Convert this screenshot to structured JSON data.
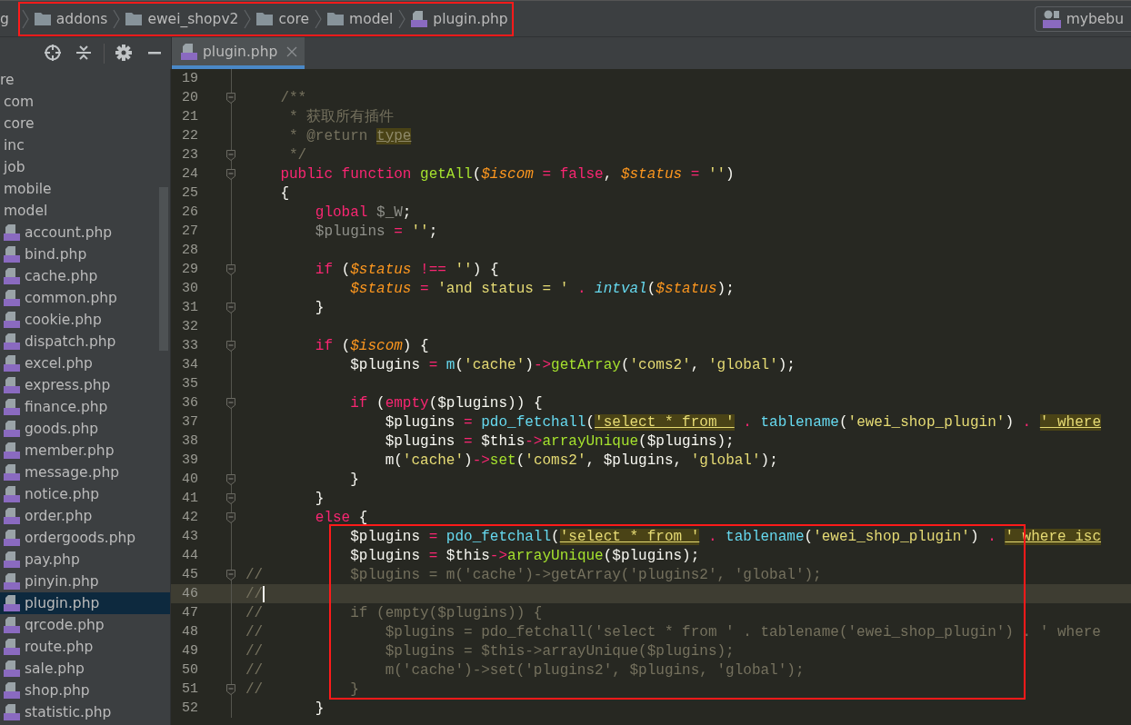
{
  "breadcrumb": {
    "outlined": true,
    "items": [
      {
        "label": "g",
        "kind": "partial"
      },
      {
        "label": "addons",
        "kind": "folder"
      },
      {
        "label": "ewei_shopv2",
        "kind": "folder"
      },
      {
        "label": "core",
        "kind": "folder"
      },
      {
        "label": "model",
        "kind": "folder"
      },
      {
        "label": "plugin.php",
        "kind": "php"
      }
    ]
  },
  "run_config": {
    "label": "mybebu"
  },
  "tabs": [
    {
      "label": "plugin.php",
      "selected": true
    }
  ],
  "sidebar": {
    "items": [
      {
        "label": "re",
        "kind": "folder",
        "selected": false
      },
      {
        "label": "com",
        "kind": "folder",
        "selected": false
      },
      {
        "label": "core",
        "kind": "folder",
        "selected": false
      },
      {
        "label": "inc",
        "kind": "folder",
        "selected": false
      },
      {
        "label": "job",
        "kind": "folder",
        "selected": false
      },
      {
        "label": "mobile",
        "kind": "folder",
        "selected": false
      },
      {
        "label": "model",
        "kind": "folder",
        "selected": false
      },
      {
        "label": "account.php",
        "kind": "php",
        "selected": false
      },
      {
        "label": "bind.php",
        "kind": "php",
        "selected": false
      },
      {
        "label": "cache.php",
        "kind": "php",
        "selected": false
      },
      {
        "label": "common.php",
        "kind": "php",
        "selected": false
      },
      {
        "label": "cookie.php",
        "kind": "php",
        "selected": false
      },
      {
        "label": "dispatch.php",
        "kind": "php",
        "selected": false
      },
      {
        "label": "excel.php",
        "kind": "php",
        "selected": false
      },
      {
        "label": "express.php",
        "kind": "php",
        "selected": false
      },
      {
        "label": "finance.php",
        "kind": "php",
        "selected": false
      },
      {
        "label": "goods.php",
        "kind": "php",
        "selected": false
      },
      {
        "label": "member.php",
        "kind": "php",
        "selected": false
      },
      {
        "label": "message.php",
        "kind": "php",
        "selected": false
      },
      {
        "label": "notice.php",
        "kind": "php",
        "selected": false
      },
      {
        "label": "order.php",
        "kind": "php",
        "selected": false
      },
      {
        "label": "ordergoods.php",
        "kind": "php",
        "selected": false
      },
      {
        "label": "pay.php",
        "kind": "php",
        "selected": false
      },
      {
        "label": "pinyin.php",
        "kind": "php",
        "selected": false
      },
      {
        "label": "plugin.php",
        "kind": "php",
        "selected": true
      },
      {
        "label": "qrcode.php",
        "kind": "php",
        "selected": false
      },
      {
        "label": "route.php",
        "kind": "php",
        "selected": false
      },
      {
        "label": "sale.php",
        "kind": "php",
        "selected": false
      },
      {
        "label": "shop.php",
        "kind": "php",
        "selected": false
      },
      {
        "label": "statistic.php",
        "kind": "php",
        "selected": false
      }
    ]
  },
  "editor": {
    "lines": [
      {
        "number": "19",
        "fold": false,
        "current": false,
        "boxed": false
      },
      {
        "number": "20",
        "fold": true,
        "current": false,
        "boxed": false,
        "tokens": [
          {
            "kind": "comment",
            "text": "    /**"
          }
        ]
      },
      {
        "number": "21",
        "fold": false,
        "current": false,
        "boxed": false,
        "tokens": [
          {
            "kind": "comment",
            "text": "     * 获取所有插件"
          }
        ]
      },
      {
        "number": "22",
        "fold": false,
        "current": false,
        "boxed": false,
        "tokens": [
          {
            "kind": "comment",
            "text": "     * @return "
          },
          {
            "kind": "doc-type",
            "text": "type"
          }
        ]
      },
      {
        "number": "23",
        "fold": true,
        "current": false,
        "boxed": false,
        "tokens": [
          {
            "kind": "comment",
            "text": "     */"
          }
        ]
      },
      {
        "number": "24",
        "fold": true,
        "current": false,
        "boxed": false,
        "tokens": [
          {
            "kind": "keyword",
            "text": "    public function "
          },
          {
            "kind": "function",
            "text": "getAll"
          },
          {
            "kind": "plain",
            "text": "("
          },
          {
            "kind": "variable",
            "text": "$iscom"
          },
          {
            "kind": "keyword",
            "text": " = false"
          },
          {
            "kind": "plain",
            "text": ", "
          },
          {
            "kind": "variable",
            "text": "$status"
          },
          {
            "kind": "keyword",
            "text": " = "
          },
          {
            "kind": "string",
            "text": "''"
          },
          {
            "kind": "plain",
            "text": ")"
          }
        ]
      },
      {
        "number": "25",
        "fold": false,
        "current": false,
        "boxed": false,
        "tokens": [
          {
            "kind": "plain",
            "text": "    {"
          }
        ]
      },
      {
        "number": "26",
        "fold": false,
        "current": false,
        "boxed": false,
        "tokens": [
          {
            "kind": "keyword",
            "text": "        global "
          },
          {
            "kind": "unused",
            "text": "$_W"
          },
          {
            "kind": "plain",
            "text": ";"
          }
        ]
      },
      {
        "number": "27",
        "fold": false,
        "current": false,
        "boxed": false,
        "tokens": [
          {
            "kind": "unused",
            "text": "        $plugins"
          },
          {
            "kind": "keyword",
            "text": " = "
          },
          {
            "kind": "string",
            "text": "''"
          },
          {
            "kind": "plain",
            "text": ";"
          }
        ]
      },
      {
        "number": "28",
        "fold": false,
        "current": false,
        "boxed": false
      },
      {
        "number": "29",
        "fold": true,
        "current": false,
        "boxed": false,
        "tokens": [
          {
            "kind": "keyword",
            "text": "        if "
          },
          {
            "kind": "plain",
            "text": "("
          },
          {
            "kind": "variable",
            "text": "$status"
          },
          {
            "kind": "keyword",
            "text": " !== "
          },
          {
            "kind": "string",
            "text": "''"
          },
          {
            "kind": "plain",
            "text": ") {"
          }
        ]
      },
      {
        "number": "30",
        "fold": false,
        "current": false,
        "boxed": false,
        "tokens": [
          {
            "kind": "variable",
            "text": "            $status"
          },
          {
            "kind": "keyword",
            "text": " = "
          },
          {
            "kind": "string",
            "text": "'and status = '"
          },
          {
            "kind": "keyword",
            "text": " . "
          },
          {
            "kind": "builtin-italic",
            "text": "intval"
          },
          {
            "kind": "plain",
            "text": "("
          },
          {
            "kind": "variable",
            "text": "$status"
          },
          {
            "kind": "plain",
            "text": ");"
          }
        ]
      },
      {
        "number": "31",
        "fold": true,
        "current": false,
        "boxed": false,
        "tokens": [
          {
            "kind": "plain",
            "text": "        }"
          }
        ]
      },
      {
        "number": "32",
        "fold": false,
        "current": false,
        "boxed": false
      },
      {
        "number": "33",
        "fold": true,
        "current": false,
        "boxed": false,
        "tokens": [
          {
            "kind": "keyword",
            "text": "        if "
          },
          {
            "kind": "plain",
            "text": "("
          },
          {
            "kind": "variable",
            "text": "$iscom"
          },
          {
            "kind": "plain",
            "text": ") {"
          }
        ]
      },
      {
        "number": "34",
        "fold": false,
        "current": false,
        "boxed": false,
        "tokens": [
          {
            "kind": "plain",
            "text": "            $plugins "
          },
          {
            "kind": "keyword",
            "text": "= "
          },
          {
            "kind": "builtin",
            "text": "m"
          },
          {
            "kind": "plain",
            "text": "("
          },
          {
            "kind": "string",
            "text": "'cache'"
          },
          {
            "kind": "plain",
            "text": ")"
          },
          {
            "kind": "keyword",
            "text": "->"
          },
          {
            "kind": "function",
            "text": "getArray"
          },
          {
            "kind": "plain",
            "text": "("
          },
          {
            "kind": "string",
            "text": "'coms2'"
          },
          {
            "kind": "plain",
            "text": ", "
          },
          {
            "kind": "string",
            "text": "'global'"
          },
          {
            "kind": "plain",
            "text": ");"
          }
        ]
      },
      {
        "number": "35",
        "fold": false,
        "current": false,
        "boxed": false
      },
      {
        "number": "36",
        "fold": true,
        "current": false,
        "boxed": false,
        "tokens": [
          {
            "kind": "keyword",
            "text": "            if "
          },
          {
            "kind": "plain",
            "text": "("
          },
          {
            "kind": "keyword",
            "text": "empty"
          },
          {
            "kind": "plain",
            "text": "($plugins)) {"
          }
        ]
      },
      {
        "number": "37",
        "fold": false,
        "current": false,
        "boxed": false,
        "tokens": [
          {
            "kind": "plain",
            "text": "                $plugins "
          },
          {
            "kind": "keyword",
            "text": "= "
          },
          {
            "kind": "builtin",
            "text": "pdo_fetchall"
          },
          {
            "kind": "plain",
            "text": "("
          },
          {
            "kind": "sql",
            "text": "'select * from '"
          },
          {
            "kind": "keyword",
            "text": " . "
          },
          {
            "kind": "builtin",
            "text": "tablename"
          },
          {
            "kind": "plain",
            "text": "("
          },
          {
            "kind": "string",
            "text": "'ewei_shop_plugin'"
          },
          {
            "kind": "plain",
            "text": ")"
          },
          {
            "kind": "keyword",
            "text": " . "
          },
          {
            "kind": "sql",
            "text": "' where"
          }
        ]
      },
      {
        "number": "38",
        "fold": false,
        "current": false,
        "boxed": false,
        "tokens": [
          {
            "kind": "plain",
            "text": "                $plugins "
          },
          {
            "kind": "keyword",
            "text": "= "
          },
          {
            "kind": "plain",
            "text": "$this"
          },
          {
            "kind": "keyword",
            "text": "->"
          },
          {
            "kind": "function",
            "text": "arrayUnique"
          },
          {
            "kind": "plain",
            "text": "($plugins);"
          }
        ]
      },
      {
        "number": "39",
        "fold": false,
        "current": false,
        "boxed": false,
        "tokens": [
          {
            "kind": "plain",
            "text": "                m("
          },
          {
            "kind": "string",
            "text": "'cache'"
          },
          {
            "kind": "plain",
            "text": ")"
          },
          {
            "kind": "keyword",
            "text": "->"
          },
          {
            "kind": "function",
            "text": "set"
          },
          {
            "kind": "plain",
            "text": "("
          },
          {
            "kind": "string",
            "text": "'coms2'"
          },
          {
            "kind": "plain",
            "text": ", $plugins, "
          },
          {
            "kind": "string",
            "text": "'global'"
          },
          {
            "kind": "plain",
            "text": ");"
          }
        ]
      },
      {
        "number": "40",
        "fold": true,
        "current": false,
        "boxed": false,
        "tokens": [
          {
            "kind": "plain",
            "text": "            }"
          }
        ]
      },
      {
        "number": "41",
        "fold": true,
        "current": false,
        "boxed": false,
        "tokens": [
          {
            "kind": "plain",
            "text": "        }"
          }
        ]
      },
      {
        "number": "42",
        "fold": true,
        "current": false,
        "boxed": false,
        "tokens": [
          {
            "kind": "keyword",
            "text": "        else "
          },
          {
            "kind": "plain",
            "text": "{"
          }
        ]
      },
      {
        "number": "43",
        "fold": false,
        "current": false,
        "boxed": true,
        "tokens": [
          {
            "kind": "plain",
            "text": "            $plugins "
          },
          {
            "kind": "keyword",
            "text": "= "
          },
          {
            "kind": "builtin",
            "text": "pdo_fetchall"
          },
          {
            "kind": "plain",
            "text": "("
          },
          {
            "kind": "sql",
            "text": "'select * from '"
          },
          {
            "kind": "keyword",
            "text": " . "
          },
          {
            "kind": "builtin",
            "text": "tablename"
          },
          {
            "kind": "plain",
            "text": "("
          },
          {
            "kind": "string",
            "text": "'ewei_shop_plugin'"
          },
          {
            "kind": "plain",
            "text": ")"
          },
          {
            "kind": "keyword",
            "text": " . "
          },
          {
            "kind": "sql",
            "text": "' where isc"
          }
        ]
      },
      {
        "number": "44",
        "fold": false,
        "current": false,
        "boxed": true,
        "tokens": [
          {
            "kind": "plain",
            "text": "            $plugins "
          },
          {
            "kind": "keyword",
            "text": "= "
          },
          {
            "kind": "plain",
            "text": "$this"
          },
          {
            "kind": "keyword",
            "text": "->"
          },
          {
            "kind": "function",
            "text": "arrayUnique"
          },
          {
            "kind": "plain",
            "text": "($plugins);"
          }
        ]
      },
      {
        "number": "45",
        "fold": true,
        "current": false,
        "boxed": true,
        "tokens": [
          {
            "kind": "comment",
            "text": "//          $plugins = m('cache')->getArray('plugins2', 'global');"
          }
        ]
      },
      {
        "number": "46",
        "fold": false,
        "current": true,
        "boxed": true,
        "tokens": [
          {
            "kind": "comment",
            "text": "//"
          }
        ]
      },
      {
        "number": "47",
        "fold": false,
        "current": false,
        "boxed": true,
        "tokens": [
          {
            "kind": "comment",
            "text": "//          if (empty($plugins)) {"
          }
        ]
      },
      {
        "number": "48",
        "fold": false,
        "current": false,
        "boxed": true,
        "tokens": [
          {
            "kind": "comment",
            "text": "//              $plugins = pdo_fetchall('select * from ' . tablename('ewei_shop_plugin') . ' where"
          }
        ]
      },
      {
        "number": "49",
        "fold": false,
        "current": false,
        "boxed": true,
        "tokens": [
          {
            "kind": "comment",
            "text": "//              $plugins = $this->arrayUnique($plugins);"
          }
        ]
      },
      {
        "number": "50",
        "fold": false,
        "current": false,
        "boxed": true,
        "tokens": [
          {
            "kind": "comment",
            "text": "//              m('cache')->set('plugins2', $plugins, 'global');"
          }
        ]
      },
      {
        "number": "51",
        "fold": true,
        "current": false,
        "boxed": true,
        "tokens": [
          {
            "kind": "comment",
            "text": "//          }"
          }
        ]
      },
      {
        "number": "52",
        "fold": false,
        "current": false,
        "boxed": false,
        "tokens": [
          {
            "kind": "plain",
            "text": "        }"
          }
        ]
      }
    ]
  }
}
